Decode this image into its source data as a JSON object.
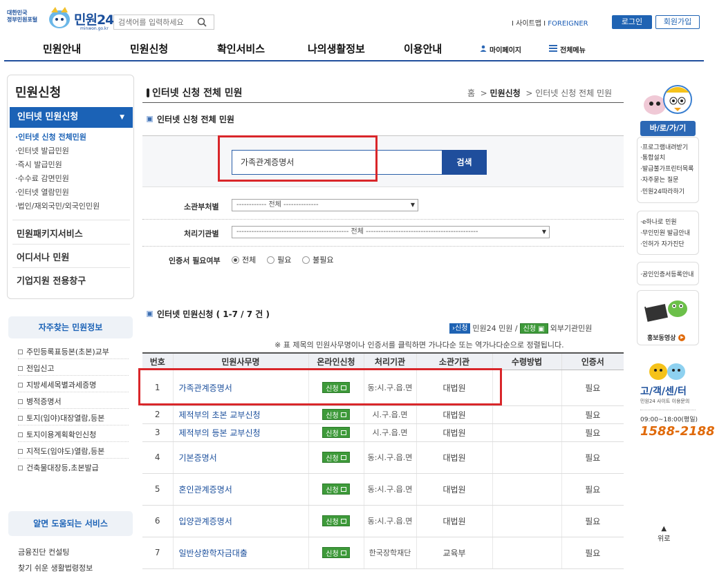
{
  "header": {
    "logo_line1": "대한민국",
    "logo_line2": "정부민원포털",
    "logo_title": "민원24",
    "logo_sub": "minwon.go.kr",
    "search_placeholder": "검색어를 입력하세요",
    "util_sitemap": "사이트맵",
    "util_foreigner": "FOREIGNER",
    "login": "로그인",
    "join": "회원가입"
  },
  "gnb": {
    "items": [
      "민원안내",
      "민원신청",
      "확인서비스",
      "나의생활정보",
      "이용안내"
    ],
    "mypage": "마이페이지",
    "allmenu": "전체메뉴"
  },
  "lnb": {
    "title": "민원신청",
    "active": "인터넷 민원신청",
    "subs": [
      "인터넷 신청 전체민원",
      "인터넷 발급민원",
      "즉시 발급민원",
      "수수료 감면민원",
      "인터넷 열람민원",
      "법인/재외국민/외국인민원"
    ],
    "mains": [
      "민원패키지서비스",
      "어디서나 민원",
      "기업지원 전용창구"
    ]
  },
  "faq": {
    "title": "자주찾는 민원정보",
    "items": [
      "주민등록표등본(초본)교부",
      "전입신고",
      "지방세세목별과세증명",
      "병적증명서",
      "토지(임야)대장열람,등본",
      "토지이용계획확인신청",
      "지적도(임야도)열람,등본",
      "건축물대장등,초본발급"
    ]
  },
  "help": {
    "title": "알면 도움되는 서비스",
    "items": [
      "금융진단 컨설팅",
      "찾기 쉬운 생활법령정보"
    ]
  },
  "main": {
    "page_title": "인터넷 신청 전체 민원",
    "breadcrumb": {
      "home": "홈",
      "level1": "민원신청",
      "level2": "인터넷 신청 전체 민원"
    },
    "section1": "인터넷 신청 전체 민원",
    "search_value": "가족관계증명서",
    "search_btn": "검색",
    "filter_dept_label": "소관부처별",
    "filter_dept_value": "------------ 전체 --------------",
    "filter_org_label": "처리기관별",
    "filter_org_value": "--------------------------------------------- 전체 ---------------------------------------------",
    "filter_cert_label": "인증서 필요여부",
    "cert_options": [
      "전체",
      "필요",
      "불필요"
    ],
    "section2": "인터넷 민원신청 ( 1-7 / 7 건 )",
    "legend_blue": "신청",
    "legend_blue_text": "민원24 민원 /",
    "legend_green": "신청",
    "legend_green_text": "외부기관민원",
    "sort_note": "※ 표 제목의 민원사무명이나 인증서를 클릭하면 가나다순 또는 역가나다순으로 정렬됩니다.",
    "apply_label": "신청"
  },
  "table": {
    "headers": [
      "번호",
      "민원사무명",
      "온라인신청",
      "처리기관",
      "소관기관",
      "수령방법",
      "인증서"
    ],
    "rows": [
      {
        "no": "1",
        "name": "가족관계증명서",
        "proc": "동:시.구.읍.면",
        "org": "대법원",
        "recv": "",
        "cert": "필요"
      },
      {
        "no": "2",
        "name": "제적부의 초본 교부신청",
        "proc": "시.구.읍.면",
        "org": "대법원",
        "recv": "",
        "cert": "필요"
      },
      {
        "no": "3",
        "name": "제적부의 등본 교부신청",
        "proc": "시.구.읍.면",
        "org": "대법원",
        "recv": "",
        "cert": "필요"
      },
      {
        "no": "4",
        "name": "기본증명서",
        "proc": "동:시.구.읍.면",
        "org": "대법원",
        "recv": "",
        "cert": "필요"
      },
      {
        "no": "5",
        "name": "혼인관계증명서",
        "proc": "동:시.구.읍.면",
        "org": "대법원",
        "recv": "",
        "cert": "필요"
      },
      {
        "no": "6",
        "name": "입양관계증명서",
        "proc": "동:시.구.읍.면",
        "org": "대법원",
        "recv": "",
        "cert": "필요"
      },
      {
        "no": "7",
        "name": "일반상환학자금대출",
        "proc": "한국장학재단",
        "org": "교육부",
        "recv": "",
        "cert": "필요"
      }
    ]
  },
  "quick": {
    "title": "바/로/가/기",
    "group1": [
      "프로그램내려받기",
      "통합설치",
      "발급불가프린터목록",
      "자주묻는 질문",
      "민원24따라하기"
    ],
    "group2": [
      "e하나로 민원",
      "무인민원 발급안내",
      "인허가 자가진단"
    ],
    "cert_guide": "공인인증서등록안내",
    "video": "홍보동영상",
    "cs_title": "고/객/센/터",
    "cs_sub": "민원24 사이트 이용문의",
    "cs_hours": "09:00~18:00(평일)",
    "cs_phone": "1588-2188",
    "top": "위로"
  }
}
